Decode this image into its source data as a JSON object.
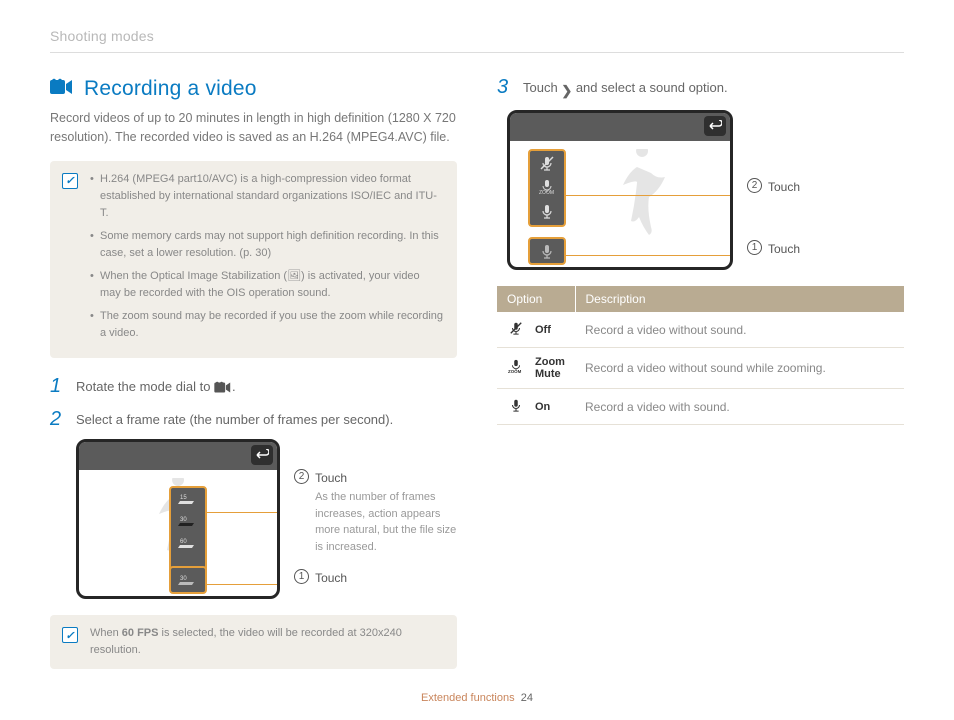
{
  "header": "Shooting modes",
  "title": "Recording a video",
  "intro": "Record videos of up to 20 minutes in length in high definition (1280 X 720 resolution). The recorded video is saved as an H.264 (MPEG4.AVC) file.",
  "note_bullets": [
    "H.264 (MPEG4 part10/AVC) is a high-compression video format established by international standard organizations ISO/IEC and ITU-T.",
    "Some memory cards may not support high definition recording. In this case, set a lower resolution. (p. 30)",
    "When the Optical Image Stabilization (🖼) is activated, your video may be recorded with the OIS operation sound.",
    "The zoom sound may be recorded if you use the zoom while recording a video."
  ],
  "steps": {
    "s1": "Rotate the mode dial to ",
    "s1_suffix": ".",
    "s2": "Select a frame rate (the number of frames per second).",
    "s3_pre": "Touch ",
    "s3_post": " and select a sound option."
  },
  "callouts": {
    "touch": "Touch",
    "fps_sub": "As the number of frames increases, action appears more natural, but the file size is increased."
  },
  "note2_pre": "When ",
  "note2_bold": "60 FPS",
  "note2_post": " is selected, the video will be recorded at 320x240 resolution.",
  "table": {
    "headers": {
      "option": "Option",
      "description": "Description"
    },
    "rows": [
      {
        "name": "Off",
        "desc": "Record a video without sound."
      },
      {
        "name": "Zoom Mute",
        "desc": "Record a video without sound while zooming."
      },
      {
        "name": "On",
        "desc": "Record a video with sound."
      }
    ]
  },
  "footer": {
    "section": "Extended functions",
    "page": "24"
  }
}
